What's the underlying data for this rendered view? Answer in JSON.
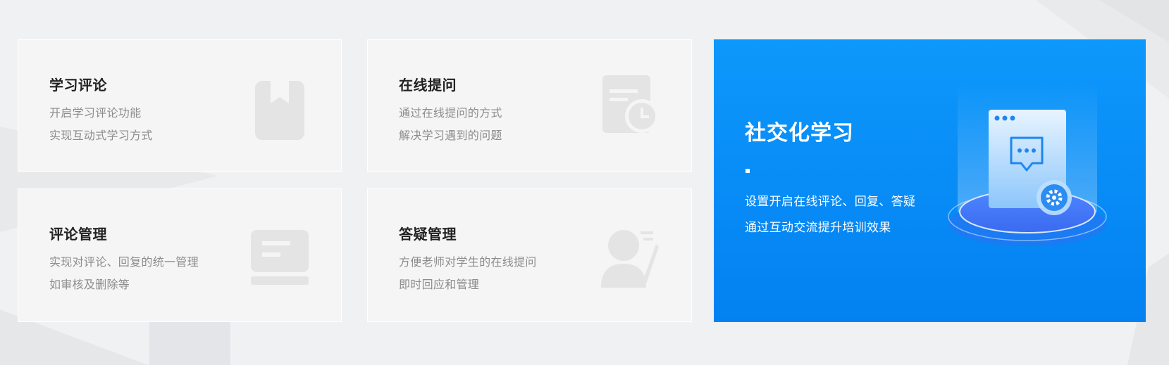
{
  "cards": [
    {
      "title": "学习评论",
      "line1": "开启学习评论功能",
      "line2": "实现互动式学习方式",
      "icon": "bookmark-book-icon"
    },
    {
      "title": "在线提问",
      "line1": "通过在线提问的方式",
      "line2": "解决学习遇到的问题",
      "icon": "document-clock-icon"
    },
    {
      "title": "评论管理",
      "line1": "实现对评论、回复的统一管理",
      "line2": "如审核及删除等",
      "icon": "comment-list-icon"
    },
    {
      "title": "答疑管理",
      "line1": "方便老师对学生的在线提问",
      "line2": "即时回应和管理",
      "icon": "user-answer-icon"
    }
  ],
  "feature": {
    "title": "社交化学习",
    "line1": "设置开启在线评论、回复、答疑",
    "line2": "通过互动交流提升培训效果",
    "illustration": "chat-document-gear-illustration",
    "color_top": "#0d98fb",
    "color_bottom": "#0381f1"
  },
  "colors": {
    "background": "#f0f1f3",
    "card": "#f5f5f5",
    "title": "#222222",
    "text": "#8c8c8c",
    "icon": "#e4e4e4"
  }
}
